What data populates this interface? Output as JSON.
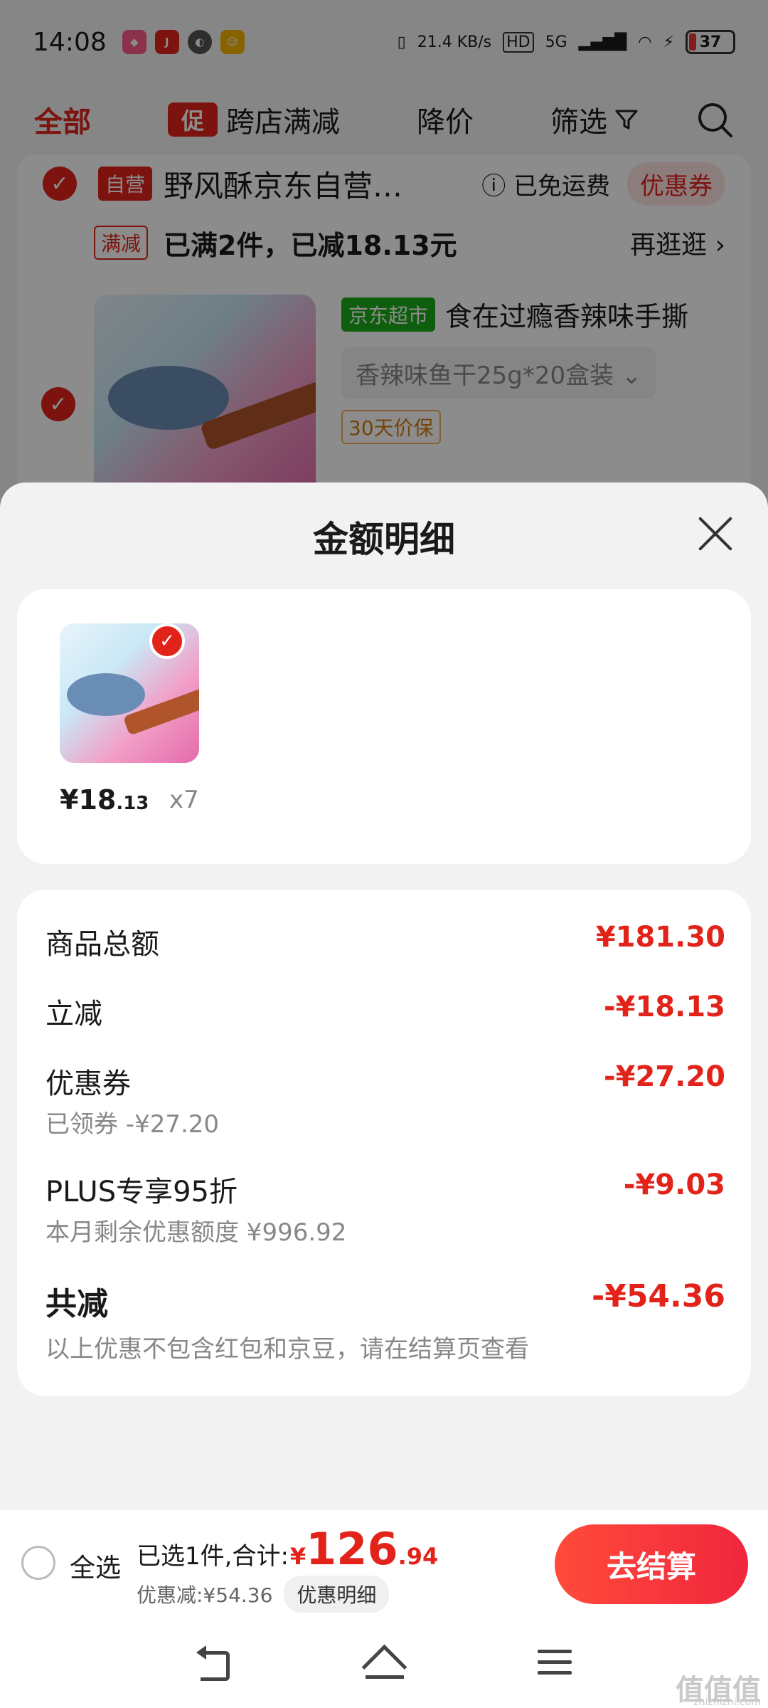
{
  "status_bar": {
    "time": "14:08",
    "net_speed": "21.4 KB/s",
    "hd": "HD",
    "network": "5G",
    "battery": "37"
  },
  "filter_bar": {
    "all": "全部",
    "promo_chip": "促",
    "cross_store": "跨店满减",
    "price_drop": "降价",
    "screen": "筛选"
  },
  "store": {
    "badge": "自营",
    "name": "野风酥京东自营…",
    "free_shipping": "已免运费",
    "coupon": "优惠券",
    "full_reduction_tag": "满减",
    "full_reduction_text": "已满2件，已减18.13元",
    "go_more": "再逛逛"
  },
  "product": {
    "channel_tag": "京东超市",
    "title": "食在过瘾香辣味手撕",
    "spec": "香辣味鱼干25g*20盒装",
    "price_protect": "30天价保"
  },
  "sheet": {
    "title": "金额明细",
    "item": {
      "price_main": "¥18",
      "price_decimal": ".13",
      "quantity": "x7"
    },
    "rows": {
      "goods_total_label": "商品总额",
      "goods_total_value": "¥181.30",
      "instant_cut_label": "立减",
      "instant_cut_value": "-¥18.13",
      "coupon_label": "优惠券",
      "coupon_value": "-¥27.20",
      "coupon_sub": "已领券 -¥27.20",
      "plus_label": "PLUS专享95折",
      "plus_value": "-¥9.03",
      "plus_sub": "本月剩余优惠额度 ¥996.92",
      "total_cut_label": "共减",
      "total_cut_value": "-¥54.36",
      "total_cut_note": "以上优惠不包含红包和京豆，请在结算页查看"
    }
  },
  "checkout": {
    "select_all": "全选",
    "selected_text": "已选1件,合计:",
    "currency": "¥",
    "price_int": "126",
    "price_dec": ".94",
    "discount_text": "优惠减:¥54.36",
    "detail_button": "优惠明细",
    "checkout_button": "去结算"
  },
  "watermark": {
    "main": "值值值",
    "sub": "zhizhizhi.com"
  },
  "colors": {
    "accent_red": "#e2231a",
    "jd_green": "#1aac19"
  }
}
